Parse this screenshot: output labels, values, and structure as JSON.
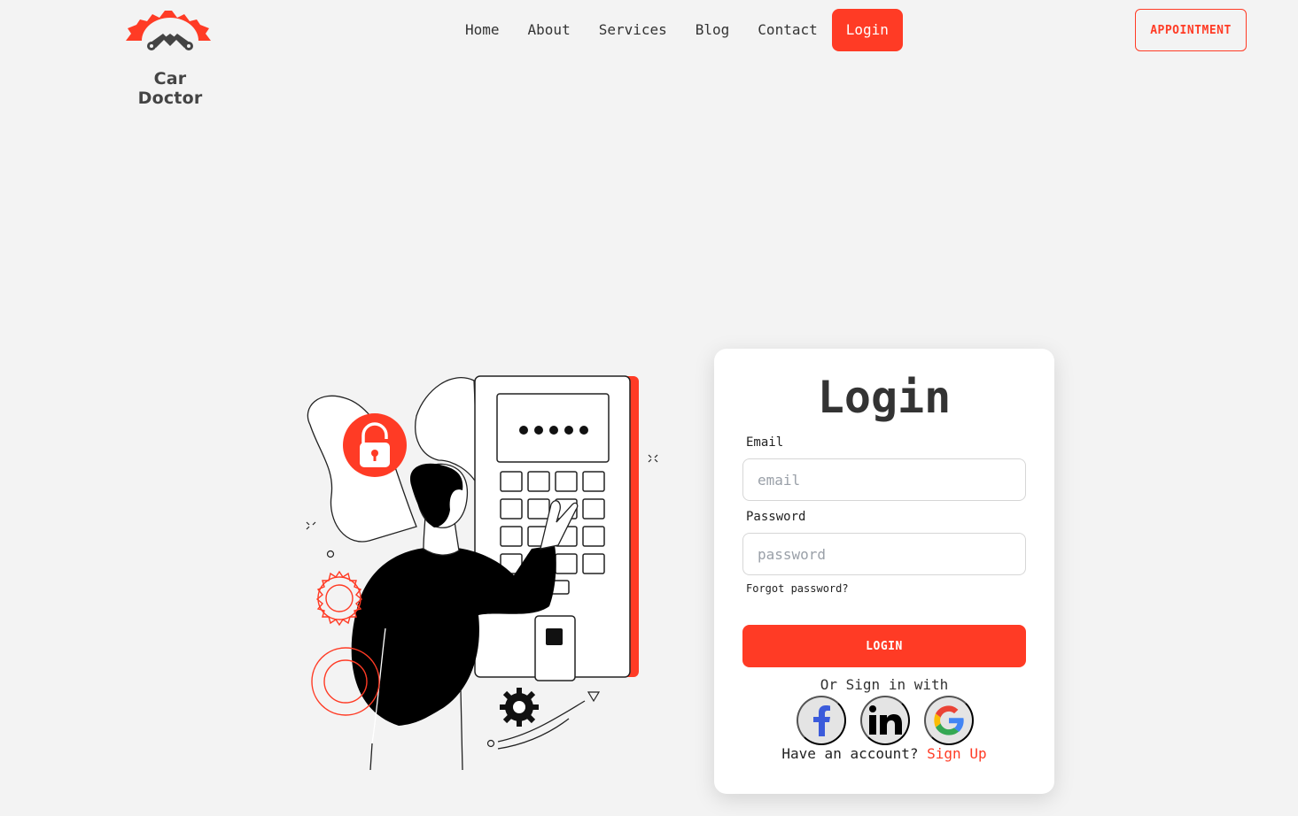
{
  "brand": {
    "name": "Car Doctor",
    "accent_color": "#ff3b25",
    "logo_icon": "gear-wrench-logo-icon"
  },
  "nav": {
    "items": [
      {
        "label": "Home",
        "active": false
      },
      {
        "label": "About",
        "active": false
      },
      {
        "label": "Services",
        "active": false
      },
      {
        "label": "Blog",
        "active": false
      },
      {
        "label": "Contact",
        "active": false
      },
      {
        "label": "Login",
        "active": true
      }
    ],
    "appointment_label": "APPOINTMENT"
  },
  "illustration": {
    "icon": "person-unlocking-keypad-illustration",
    "password_dots": "•••••"
  },
  "login_form": {
    "title": "Login",
    "email_label": "Email",
    "email_placeholder": "email",
    "email_value": "",
    "password_label": "Password",
    "password_placeholder": "password",
    "password_value": "",
    "forgot_label": "Forgot password?",
    "submit_label": "LOGIN",
    "or_text": "Or Sign in with",
    "social": [
      {
        "name": "facebook",
        "icon": "facebook-icon"
      },
      {
        "name": "linkedin",
        "icon": "linkedin-icon"
      },
      {
        "name": "google",
        "icon": "google-icon"
      }
    ],
    "signup_prompt": "Have an account?",
    "signup_link": "Sign Up"
  }
}
